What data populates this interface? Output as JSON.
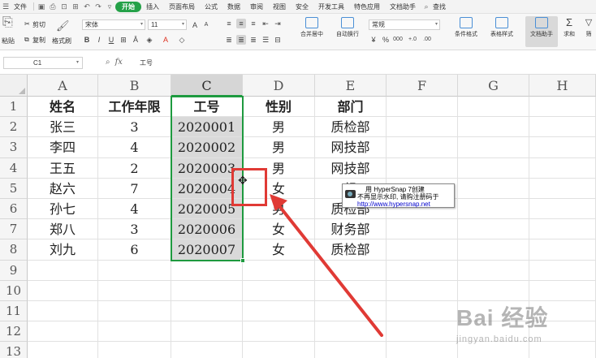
{
  "menubar": {
    "file_label": "文件",
    "items": [
      "插入",
      "页面布局",
      "公式",
      "数据",
      "审阅",
      "视图",
      "安全",
      "开发工具",
      "特色应用",
      "文档助手"
    ],
    "active_tab": "开始",
    "search_label": "查找"
  },
  "ribbon": {
    "cut": "剪切",
    "paste": "粘贴",
    "copy": "复制",
    "format_painter": "格式刷",
    "font_name": "宋体",
    "font_size": "11",
    "merge_center": "合并居中",
    "auto_wrap": "自动换行",
    "number_format": "常规",
    "conditional_format": "条件格式",
    "table_style": "表格样式",
    "doc_helper": "文档助手",
    "sum": "求和",
    "filter": "筛"
  },
  "formula_bar": {
    "name_box": "C1",
    "content": "工号"
  },
  "columns": [
    "A",
    "B",
    "C",
    "D",
    "E",
    "F",
    "G",
    "H"
  ],
  "rows": [
    "1",
    "2",
    "3",
    "4",
    "5",
    "6",
    "7",
    "8",
    "9",
    "10",
    "11",
    "12",
    "13"
  ],
  "table": [
    [
      "姓名",
      "工作年限",
      "工号",
      "性别",
      "部门"
    ],
    [
      "张三",
      "3",
      "2020001",
      "男",
      "质检部"
    ],
    [
      "李四",
      "4",
      "2020002",
      "男",
      "网技部"
    ],
    [
      "王五",
      "2",
      "2020003",
      "男",
      "网技部"
    ],
    [
      "赵六",
      "7",
      "2020004",
      "女",
      "组"
    ],
    [
      "孙七",
      "4",
      "2020005",
      "男",
      "质检部"
    ],
    [
      "郑八",
      "3",
      "2020006",
      "女",
      "财务部"
    ],
    [
      "刘九",
      "6",
      "2020007",
      "女",
      "质检部"
    ]
  ],
  "tooltip": {
    "line1": "用 HyperSnap 7创建",
    "line2": "不再显示水印, 请购注册码于",
    "line3": "http://www.hypersnap.net"
  },
  "watermark": {
    "line1": "Bai 经验",
    "line2": "jingyan.baidu.com"
  },
  "colors": {
    "accent_green": "#1e9a3f",
    "annotation_red": "#e03a35"
  }
}
